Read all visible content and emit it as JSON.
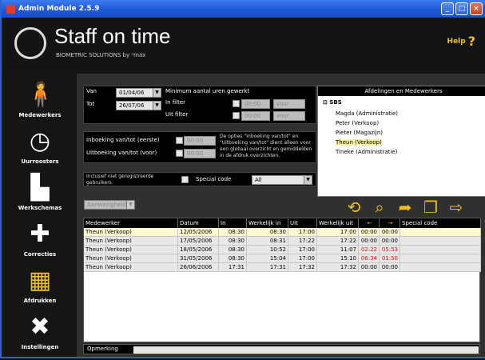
{
  "window": {
    "title": "Admin Module 2.5.9",
    "buttons": [
      "_",
      "□",
      "×"
    ]
  },
  "brand": {
    "name": "Staff on time",
    "subtitle": "BIOMETRIC SOLUTIONS by ⁿmax"
  },
  "help": {
    "label": "Help",
    "icon": "question-icon"
  },
  "sidebar": {
    "items": [
      {
        "label": "Medewerkers",
        "icon": "person-icon"
      },
      {
        "label": "Uurroosters",
        "icon": "clock-icon"
      },
      {
        "label": "Werkschemas",
        "icon": "factory-icon"
      },
      {
        "label": "Correcties",
        "icon": "first-aid-icon"
      },
      {
        "label": "Afdrukken",
        "icon": "chart-icon",
        "active": true
      },
      {
        "label": "Instellingen",
        "icon": "tools-icon"
      }
    ]
  },
  "filters": {
    "van_label": "Van",
    "van_value": "01/04/06",
    "tot_label": "Tot",
    "tot_value": "26/07/06",
    "min_label": "Minimum aantal uren gewerkt",
    "in_filter_label": "In filter",
    "in_filter_time": "00:00",
    "in_filter_select": "voor",
    "uit_filter_label": "Uit filter",
    "uit_filter_time": "00:00",
    "uit_filter_select": "voor",
    "inboeking_label": "Inboeking van/tot (eerste)",
    "inboeking_time": "00:00",
    "uitboeking_label": "Uitboeking van/tot (voor)",
    "uitboeking_time": "00:00",
    "note": "De opties \"Inboeking van/tot\" en \"Uitboeking van/tot\" dient alleen voor een globaal overzicht en gemiddelden in de afdruk overzichten.",
    "inclusief_label": "Inclusief niet geregistreerde gebruikers",
    "special_label": "Special code",
    "special_value": "All",
    "aanwezigheid": "Aanwezigheid"
  },
  "tree": {
    "header": "Afdelingen en Medewerkers",
    "root": "SBS",
    "items": [
      "Magda (Administratie)",
      "Peter (Verkoop)",
      "Pieter (Magazijn)",
      "Theun (Verkoop)",
      "Tineke (Administratie)"
    ],
    "selected_index": 3
  },
  "actions": [
    "reset-icon",
    "search-icon",
    "export-icon",
    "copy-icon",
    "exit-icon"
  ],
  "grid": {
    "headers": [
      "Medewerker",
      "Datum",
      "In",
      "Werkelijk in",
      "Uit",
      "Werkelijk uit",
      "←",
      "→",
      "Special code"
    ],
    "rows": [
      [
        "Theun (Verkoop)",
        "12/05/2006",
        "08:30",
        "08:30",
        "17:00",
        "17:00",
        "00:00",
        "00:00",
        ""
      ],
      [
        "Theun (Verkoop)",
        "17/05/2006",
        "08:30",
        "08:31",
        "17:22",
        "17:22",
        "00:00",
        "00:00",
        ""
      ],
      [
        "Theun (Verkoop)",
        "18/05/2006",
        "08:30",
        "10:52",
        "17:00",
        "11:07",
        "02:22",
        "05:53",
        ""
      ],
      [
        "Theun (Verkoop)",
        "31/05/2006",
        "08:30",
        "15:04",
        "17:00",
        "15:10",
        "06:34",
        "01:50",
        ""
      ],
      [
        "Theun (Verkoop)",
        "26/06/2006",
        "17:31",
        "17:31",
        "17:32",
        "17:32",
        "00:00",
        "00:00",
        ""
      ]
    ],
    "red_cells": [
      [
        2,
        6
      ],
      [
        2,
        7
      ],
      [
        3,
        6
      ],
      [
        3,
        7
      ]
    ]
  },
  "status": {
    "label": "Opmerking",
    "value": ""
  }
}
